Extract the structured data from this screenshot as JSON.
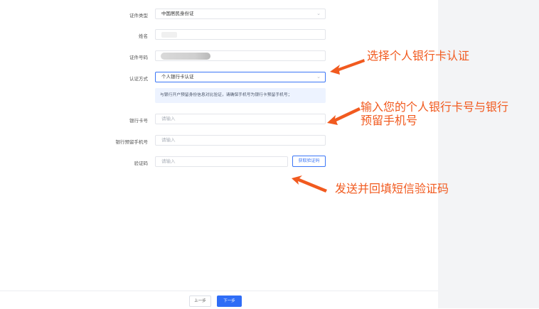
{
  "form": {
    "id_type_label": "证件类型",
    "id_type_value": "中国居民身份证",
    "name_label": "姓名",
    "id_number_label": "证件号码",
    "auth_method_label": "认证方式",
    "auth_method_value": "个人银行卡认证",
    "tip": "与银行开户预留身份信息对比验证，请确保手机号为银行卡预留手机号；",
    "bank_card_label": "银行卡号",
    "bank_card_placeholder": "请输入",
    "bank_phone_label": "银行预留手机号",
    "bank_phone_placeholder": "请输入",
    "code_label": "验证码",
    "code_placeholder": "请输入",
    "get_code_button": "获取验证码"
  },
  "footer": {
    "prev_button": "上一步",
    "next_button": "下一步"
  },
  "annotations": {
    "select_auth": "选择个人银行卡认证",
    "enter_card_line1": "输入您的个人银行卡号与银行",
    "enter_card_line2": "预留手机号",
    "send_code": "发送并回填短信验证码"
  },
  "colors": {
    "accent": "#3b76f6",
    "annotation": "#f15a1f"
  },
  "icons": {
    "dropdown": "chevron-down-icon"
  }
}
